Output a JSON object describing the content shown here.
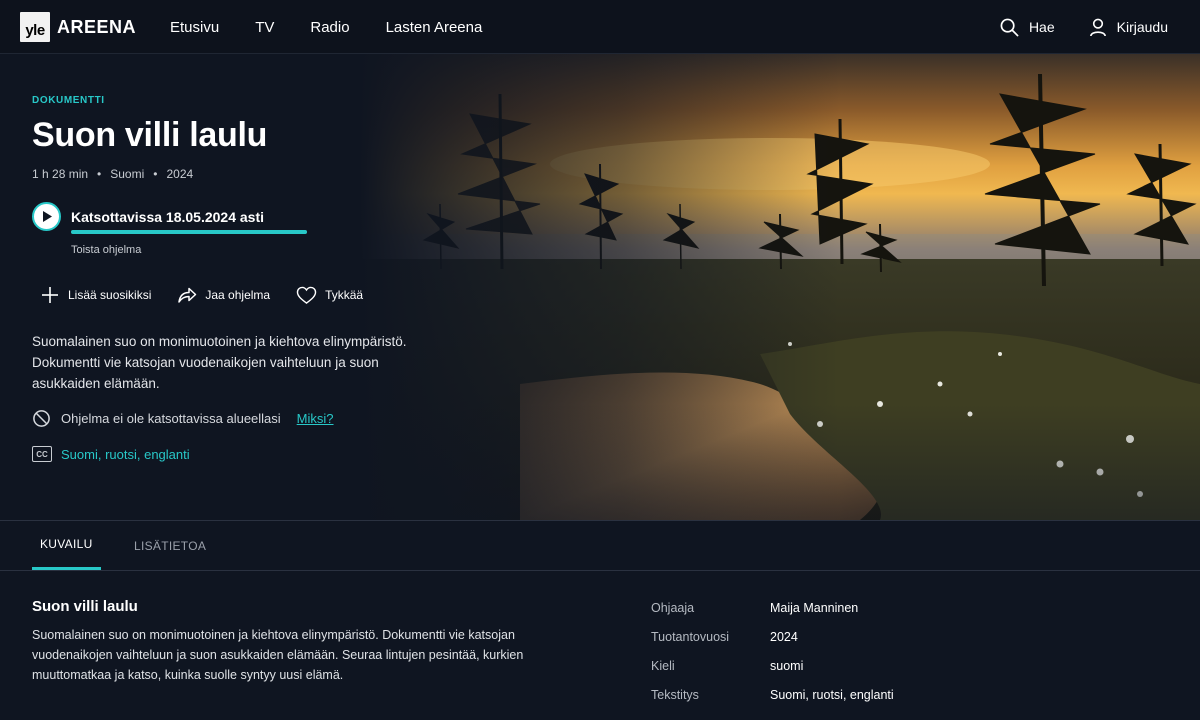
{
  "brand": {
    "logo_text": "yle",
    "name": "AREENA"
  },
  "nav": {
    "items": [
      {
        "label": "Etusivu"
      },
      {
        "label": "TV"
      },
      {
        "label": "Radio"
      },
      {
        "label": "Lasten Areena"
      }
    ],
    "search_label": "Hae",
    "login_label": "Kirjaudu"
  },
  "program": {
    "genre": "DOKUMENTTI",
    "title": "Suon villi laulu",
    "duration": "1 h 28 min",
    "country": "Suomi",
    "year": "2024",
    "availability": "Katsottavissa 18.05.2024 asti",
    "play_progress": 1.0,
    "play_label": "Toista ohjelma",
    "actions": {
      "favorite": "Lisää suosikiksi",
      "share": "Jaa ohjelma",
      "like": "Tykkää"
    },
    "short_description": "Suomalainen suo on monimuotoinen ja kiehtova elinympäristö. Dokumentti vie katsojan vuodenaikojen vaihteluun ja suon asukkaiden elämään.",
    "region_notice": "Ohjelma ei ole katsottavissa alueellasi",
    "region_link": "Miksi?",
    "subtitles": "Suomi, ruotsi, englanti",
    "cc_icon_text": "CC"
  },
  "tabs": [
    {
      "label": "KUVAILU",
      "active": true
    },
    {
      "label": "LISÄTIETOA",
      "active": false
    }
  ],
  "details": {
    "title": "Suon villi laulu",
    "description": "Suomalainen suo on monimuotoinen ja kiehtova elinympäristö. Dokumentti vie katsojan vuodenaikojen vaihteluun ja suon asukkaiden elämään. Seuraa lintujen pesintää, kurkien muuttomatkaa ja katso, kuinka suolle syntyy uusi elämä.",
    "info": [
      {
        "key": "Ohjaaja",
        "value": "Maija Manninen"
      },
      {
        "key": "Tuotantovuosi",
        "value": "2024"
      },
      {
        "key": "Kieli",
        "value": "suomi"
      },
      {
        "key": "Tekstitys",
        "value": "Suomi, ruotsi, englanti"
      }
    ]
  },
  "colors": {
    "accent": "#28c8c8",
    "background": "#0f1521",
    "nav_background": "#0d121c"
  }
}
